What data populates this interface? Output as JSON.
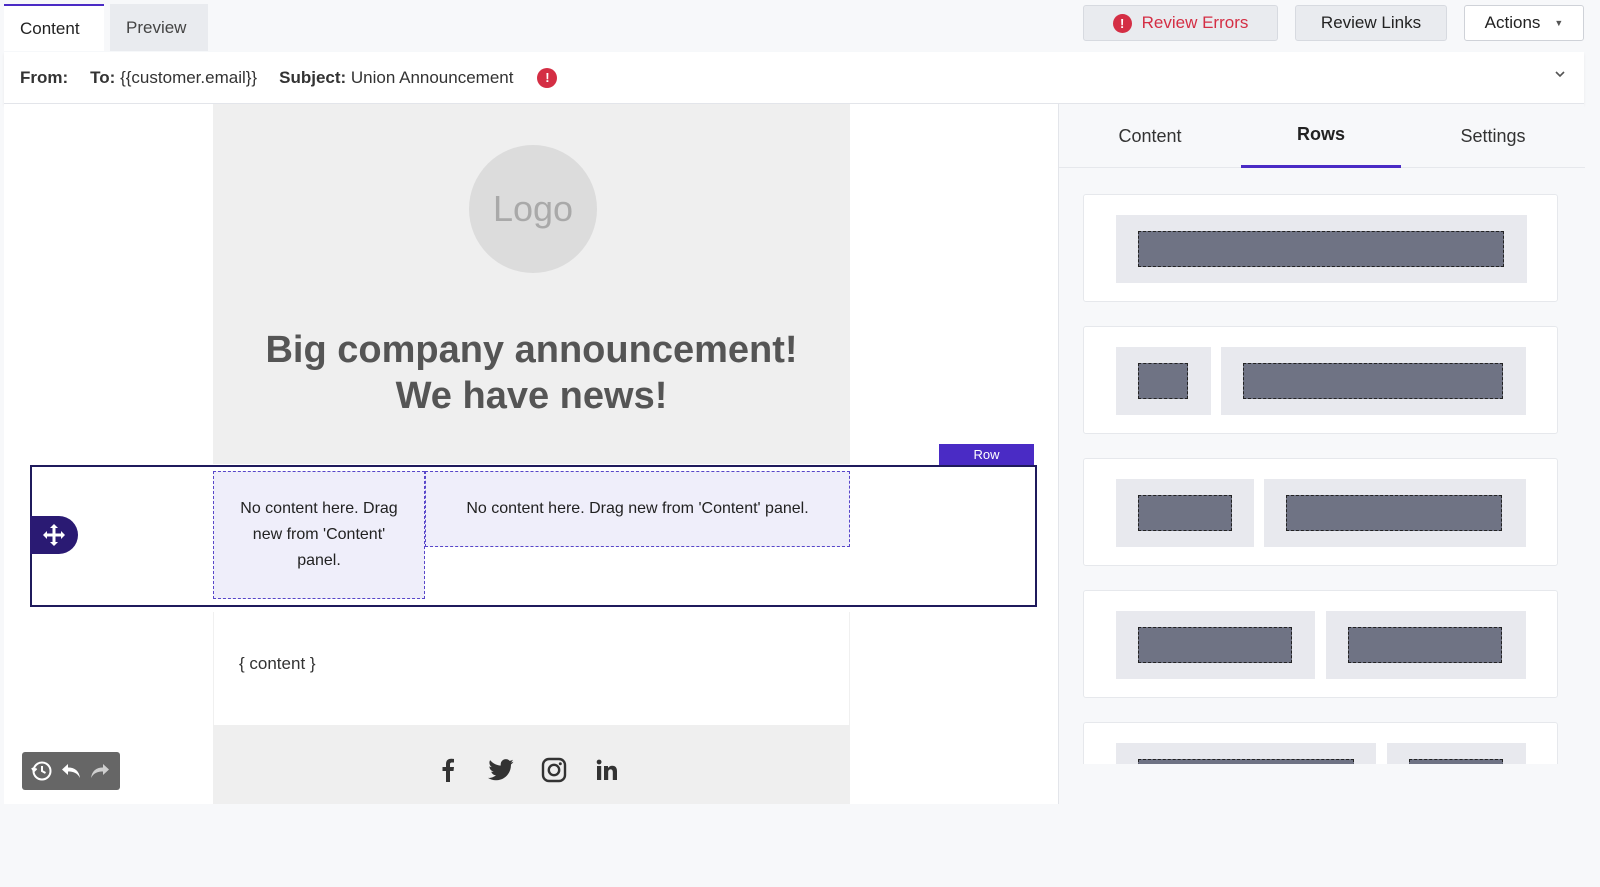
{
  "top_tabs": [
    {
      "label": "Content",
      "active": true
    },
    {
      "label": "Preview",
      "active": false
    }
  ],
  "toolbar": {
    "review_errors": "Review Errors",
    "error_glyph": "!",
    "review_links": "Review Links",
    "actions": "Actions",
    "actions_caret": "▼"
  },
  "header": {
    "from_label": "From:",
    "to_label": "To:",
    "to_value": "{{customer.email}}",
    "subject_label": "Subject:",
    "subject_value": "Union Announcement",
    "warn_glyph": "!"
  },
  "email": {
    "logo_text": "Logo",
    "headline_line1": "Big company announcement!",
    "headline_line2": "We have news!",
    "row_label": "Row",
    "col1_text": "No content here. Drag new from 'Content' panel.",
    "col2_text": "No content here. Drag new from 'Content' panel.",
    "content_placeholder": "{ content }",
    "social_icons": [
      "facebook-icon",
      "twitter-icon",
      "instagram-icon",
      "linkedin-icon"
    ]
  },
  "side_panel": {
    "tabs": [
      {
        "label": "Content",
        "active": false
      },
      {
        "label": "Rows",
        "active": true
      },
      {
        "label": "Settings",
        "active": false
      }
    ]
  },
  "colors": {
    "accent": "#4a2bc5",
    "error": "#d42e44",
    "row_border": "#1f1a5c"
  }
}
